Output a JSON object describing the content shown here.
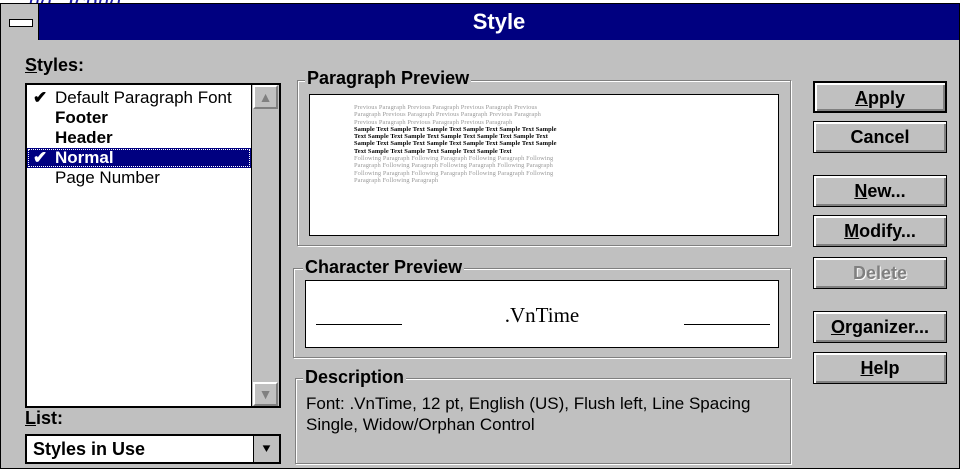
{
  "partial_heading": "ng, Jcbng",
  "window": {
    "title": "Style"
  },
  "styles_panel": {
    "label_key": "S",
    "label_rest": "tyles:",
    "items": [
      {
        "label": "Default Paragraph Font",
        "checked": true,
        "bold": false,
        "selected": false
      },
      {
        "label": "Footer",
        "checked": false,
        "bold": true,
        "selected": false
      },
      {
        "label": "Header",
        "checked": false,
        "bold": true,
        "selected": false
      },
      {
        "label": "Normal",
        "checked": true,
        "bold": true,
        "selected": true
      },
      {
        "label": "Page Number",
        "checked": false,
        "bold": false,
        "selected": false
      }
    ],
    "check_glyph": "✔"
  },
  "list_panel": {
    "label_key": "L",
    "label_rest": "ist:",
    "selected": "Styles in Use"
  },
  "paragraph_preview": {
    "title": "Paragraph Preview",
    "previous_lines": [
      "Previous Paragraph Previous Paragraph Previous Paragraph Previous",
      "Paragraph Previous Paragraph Previous Paragraph Previous Paragraph",
      "Previous Paragraph Previous Paragraph Previous Paragraph"
    ],
    "sample_lines": [
      "Sample Text Sample Text Sample Text Sample Text Sample Text Sample",
      "Text Sample Text Sample Text Sample Text Sample Text Sample Text",
      "Sample Text Sample Text Sample Text Sample Text Sample Text Sample",
      "Text Sample Text Sample Text Sample Text Sample Text"
    ],
    "following_lines": [
      "Following Paragraph Following Paragraph Following Paragraph Following",
      "Paragraph Following Paragraph Following Paragraph Following Paragraph",
      "Following Paragraph Following Paragraph Following Paragraph Following",
      "Paragraph Following Paragraph"
    ]
  },
  "character_preview": {
    "title": "Character Preview",
    "sample": ".VnTime"
  },
  "description": {
    "title": "Description",
    "text": "Font: .VnTime, 12 pt, English (US), Flush left, Line Spacing Single, Widow/Orphan Control"
  },
  "buttons": {
    "apply": {
      "key": "A",
      "rest": "pply"
    },
    "cancel": {
      "label": "Cancel"
    },
    "new": {
      "key": "N",
      "rest": "ew..."
    },
    "modify": {
      "key": "M",
      "rest": "odify..."
    },
    "delete": {
      "label": "Delete"
    },
    "organizer": {
      "key": "O",
      "rest": "rganizer..."
    },
    "help": {
      "key": "H",
      "rest": "elp"
    }
  },
  "icons": {
    "scroll_up": "▲",
    "scroll_down": "▼",
    "dropdown": "⯆"
  },
  "colors": {
    "titlebar": "#000080",
    "face": "#c0c0c0",
    "selection": "#000080",
    "disabled_text": "#808080"
  }
}
